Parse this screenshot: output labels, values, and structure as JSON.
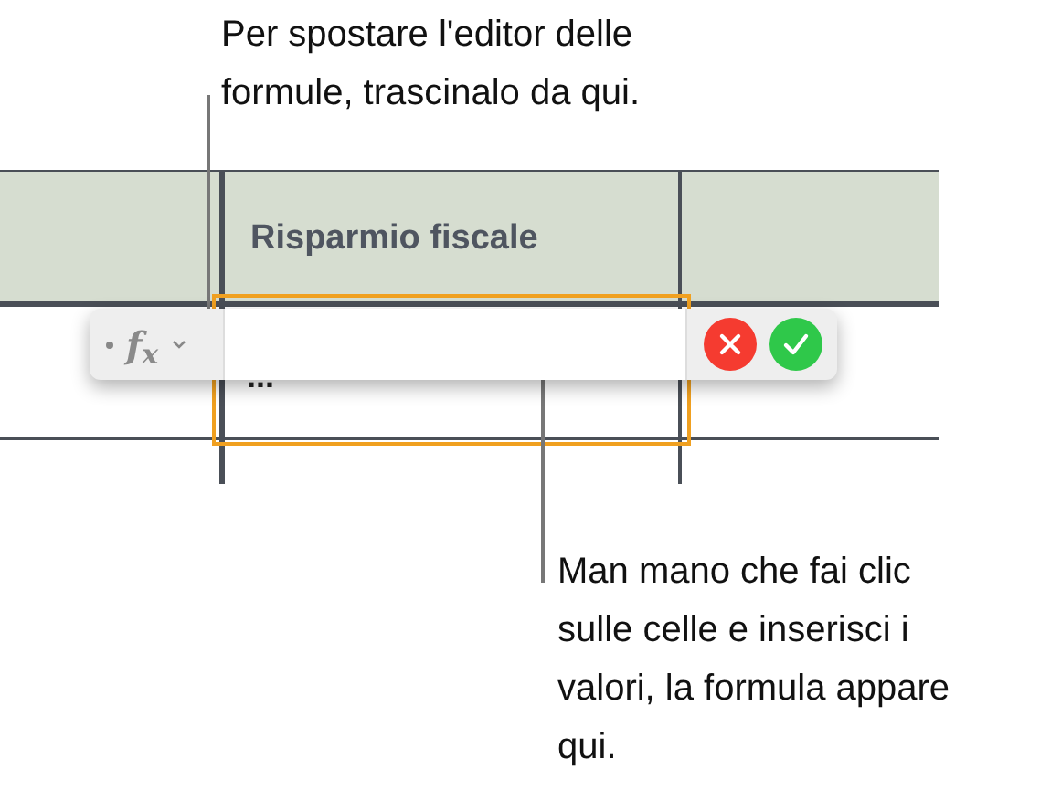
{
  "callouts": [
    {
      "text": "Per spostare l'editor delle formule, trascinalo da qui."
    },
    {
      "text": "Man mano che fai clic sulle celle e inserisci i valori, la formula appare qui."
    }
  ],
  "table": {
    "header": "Risparmio fiscale",
    "cell": "..."
  },
  "formula_editor": {
    "label": "f$_{x}$"
  }
}
